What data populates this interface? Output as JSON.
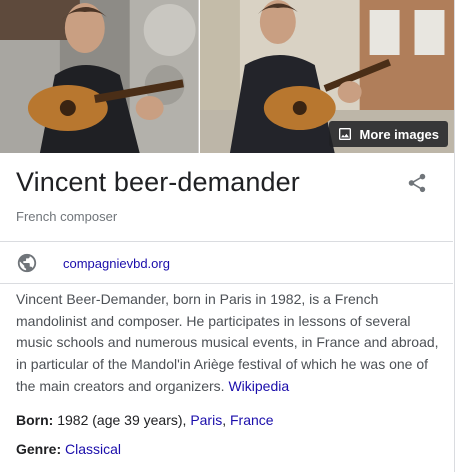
{
  "images": {
    "more_images_label": "More images"
  },
  "entity": {
    "name": "Vincent beer-demander",
    "subtitle": "French composer"
  },
  "website": {
    "label": "compagnievbd.org"
  },
  "description": {
    "text": "Vincent Beer-Demander, born in Paris in 1982, is a French mandolinist and composer. He participates in lessons of several music schools and numerous musical events, in France and abroad, in particular of the Mandol'in Ariège festival of which he was one of the main creators and organizers.",
    "source_link": "Wikipedia"
  },
  "facts": {
    "born": {
      "label": "Born:",
      "value": "1982 (age 39 years),",
      "link_city": "Paris",
      "separator": ",",
      "link_country": "France"
    },
    "genre": {
      "label": "Genre:",
      "link": "Classical"
    }
  },
  "colors": {
    "link": "#1a0dab",
    "text": "#202124",
    "secondary": "#70757a",
    "divider": "#dadce0"
  },
  "icons": [
    "image-icon",
    "share-icon",
    "globe-icon"
  ]
}
